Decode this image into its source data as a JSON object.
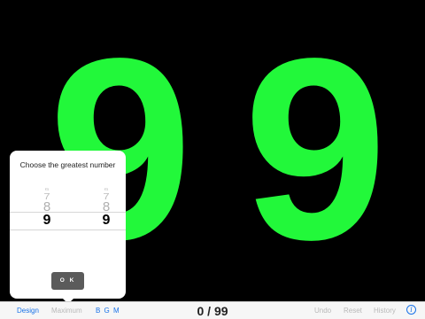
{
  "display": {
    "left_digit": "9",
    "right_digit": "9",
    "digit_color": "#22f83a",
    "background_color": "#000000"
  },
  "popover": {
    "title": "Choose the greatest number",
    "left_wheel": {
      "above": [
        "6",
        "7",
        "8"
      ],
      "selected": "9"
    },
    "right_wheel": {
      "above": [
        "6",
        "7",
        "8"
      ],
      "selected": "9"
    },
    "ok_label": "O K"
  },
  "toolbar": {
    "design_label": "Design",
    "maximum_label": "Maximum",
    "bgm_label": "B G M",
    "counter_text": "0 / 99",
    "undo_label": "Undo",
    "reset_label": "Reset",
    "history_label": "History",
    "info_glyph": "i",
    "accent_color": "#1a73e8"
  }
}
